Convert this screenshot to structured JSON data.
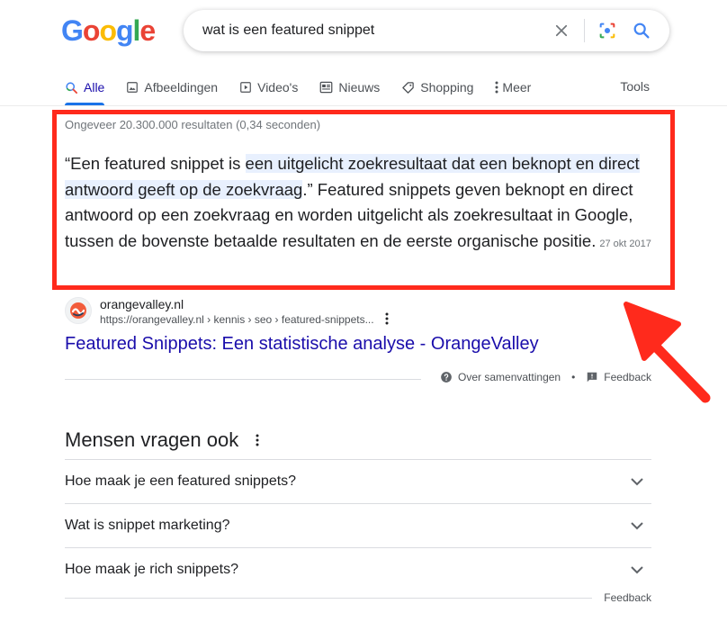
{
  "logo": {
    "letters": [
      "G",
      "o",
      "o",
      "g",
      "l",
      "e"
    ],
    "colors": [
      "#4285F4",
      "#EA4335",
      "#FBBC05",
      "#4285F4",
      "#34A853",
      "#EA4335"
    ]
  },
  "search": {
    "query": "wat is een featured snippet"
  },
  "tabs": [
    {
      "label": "Alle",
      "icon": "search-icon",
      "active": true
    },
    {
      "label": "Afbeeldingen",
      "icon": "image-icon"
    },
    {
      "label": "Video's",
      "icon": "video-icon"
    },
    {
      "label": "Nieuws",
      "icon": "news-icon"
    },
    {
      "label": "Shopping",
      "icon": "tag-icon"
    },
    {
      "label": "Meer",
      "icon": "more-vert-icon"
    }
  ],
  "tools_label": "Tools",
  "result_stats": "Ongeveer 20.300.000 resultaten (0,34 seconden)",
  "snippet": {
    "prefix": "“Een featured snippet is ",
    "highlight": "een uitgelicht zoekresultaat dat een beknopt en direct antwoord geeft op de zoekvraag",
    "suffix": ".” Featured snippets geven beknopt en direct antwoord op een zoekvraag en worden uitgelicht als zoekresultaat in Google, tussen de bovenste betaalde resultaten en de eerste organische positie.",
    "date": "27 okt 2017"
  },
  "source": {
    "site_name": "orangevalley.nl",
    "url": "https://orangevalley.nl › kennis › seo › featured-snippets...",
    "title": "Featured Snippets: Een statistische analyse - OrangeValley"
  },
  "about": {
    "about_label": "Over samenvattingen",
    "separator": "•",
    "feedback_label": "Feedback"
  },
  "paa": {
    "title": "Mensen vragen ook",
    "questions": [
      "Hoe maak je een featured snippets?",
      "Wat is snippet marketing?",
      "Hoe maak je rich snippets?"
    ],
    "feedback_label": "Feedback"
  },
  "colors": {
    "accent": "#1a73e8",
    "link": "#1a0dab",
    "highlight_box": "#ff2a1c",
    "highlight_bg": "#e8f0fe"
  }
}
